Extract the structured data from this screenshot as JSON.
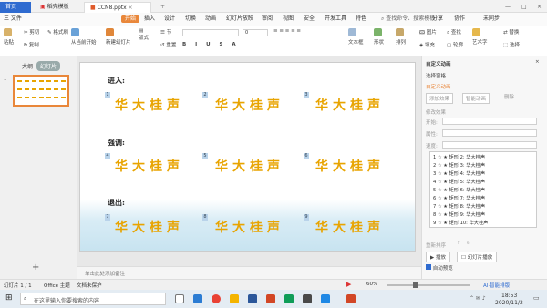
{
  "tabs": {
    "home": "首页",
    "templates": "稻壳模板",
    "file": "CCN8.pptx"
  },
  "menu": {
    "file": "三 文件",
    "start": "开始",
    "insert": "插入",
    "design": "设计",
    "transition": "切换",
    "animation": "动画",
    "slideshow": "幻灯片放映",
    "review": "审阅",
    "view": "视图",
    "security": "安全",
    "devtools": "开发工具",
    "special": "特色",
    "search": "查找命令、搜索模板",
    "share": "分享",
    "collab": "协作",
    "cloud": "未同步"
  },
  "toolbar": {
    "paste": "粘贴",
    "cut": "剪切",
    "format": "格式刷",
    "copy": "复制",
    "from_current": "从当前开始",
    "new_slide": "新建幻灯片",
    "layout": "版式",
    "section": "节",
    "reset": "重置",
    "textbox": "文本框",
    "shape": "形状",
    "arrange": "排列",
    "image": "图片",
    "fill": "填充",
    "find": "查找",
    "outline": "轮廓",
    "replace": "替换",
    "select": "选择",
    "wordart": "艺术字",
    "fontsize": "0"
  },
  "left": {
    "outline": "大纲",
    "slides": "幻灯片",
    "slide_no": "1"
  },
  "slide": {
    "enter": "进入:",
    "emphasis": "强调:",
    "exit": "退出:",
    "fx_text": "华大桂声",
    "nums": [
      "1",
      "2",
      "3",
      "4",
      "5",
      "6",
      "7",
      "8",
      "9"
    ]
  },
  "notes": {
    "placeholder": "单击此处添加备注"
  },
  "right": {
    "title": "自定义动画",
    "select_pane": "选择窗格",
    "custom": "自定义动画",
    "add_effect": "添加效果",
    "smart": "智能动画",
    "delete": "删除",
    "modify": "修改效果",
    "start": "开始:",
    "prop": "属性:",
    "speed": "速度:",
    "items": [
      "1 ☆ ★ 矩形 2: 华大桂声",
      "2 ☆ ★ 矩形 3: 华大桂声",
      "3 ☆ ★ 矩形 4: 华大桂声",
      "4 ☆ ★ 矩形 5: 华大桂声",
      "5 ☆ ★ 矩形 6: 华大桂声",
      "6 ☆ ★ 矩形 7: 华大桂声",
      "7 ☆ ★ 矩形 8: 华大桂声",
      "8 ☆ ★ 矩形 9: 华大桂声",
      "9 ☆ ★ 矩形 10: 华大桂声"
    ],
    "reorder": "重新排序",
    "play": "播放",
    "slideshow": "幻灯片播放",
    "autopreview": "自动预览"
  },
  "status": {
    "slide": "幻灯片 1 / 1",
    "theme": "Office 主题",
    "protect": "文档未保护",
    "zoom": "60%",
    "ai": "AI·智能排版"
  },
  "taskbar": {
    "search": "在这里输入你要搜索的内容",
    "time": "18:53",
    "date": "2020/11/2"
  }
}
